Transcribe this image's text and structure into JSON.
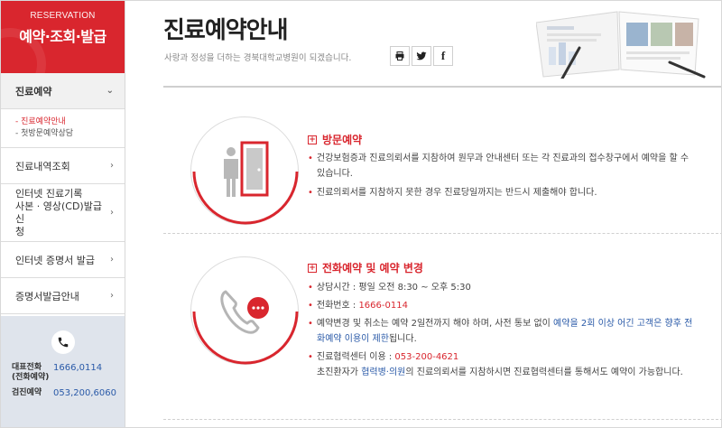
{
  "sidebar": {
    "header_eng": "RESERVATION",
    "header_title": "예약·조회·발급",
    "menu": {
      "reservation": "진료예약",
      "sub_guide": "- 진료예약안내",
      "sub_first": "- 첫방문예약상담",
      "history": "진료내역조회",
      "internet_record_1": "인터넷 진료기록",
      "internet_record_2": "사본 · 영상(CD)발급 신",
      "internet_record_3": "청",
      "cert_internet": "인터넷 증명서 발급",
      "cert_guide": "증명서발급안내"
    },
    "call": {
      "rep_label_1": "대표전화",
      "rep_label_2": "(전화예약)",
      "rep_num": "1666,0114",
      "check_label": "검진예약",
      "check_num": "053,200,6060"
    }
  },
  "header": {
    "title": "진료예약안내",
    "subtitle": "사랑과 정성을 더하는 경북대학교병원이 되겠습니다."
  },
  "share": {
    "print_icon": "print-icon",
    "twitter_icon": "twitter-icon",
    "facebook_icon": "facebook-icon",
    "facebook_glyph": "f"
  },
  "visit": {
    "title": "방문예약",
    "line1a": "건강보험증과 진료의뢰서를 지참하여 원무과 안내센터 또는 각 진료과의 접수창구에서 예약을 할 수",
    "line1b": "있습니다.",
    "line2": "진료의뢰서를 지참하지 못한 경우 진료당일까지는 반드시 제출해야 합니다."
  },
  "phone": {
    "title": "전화예약 및 예약 변경",
    "hours": "상담시간 : 평일 오전 8:30 ~ 오후 5:30",
    "tel_label": "전화번호 : ",
    "tel_num": "1666-0114",
    "change_a1": "예약변경 및 취소는 예약 2일전까지 해야 하며, 사전 통보 없이 ",
    "change_a2": "예약을 2회 이상 어긴 고객은 향후 전",
    "change_b1": "화예약 이용이 제한",
    "change_b2": "됩니다.",
    "center_label": "진료협력센터 이용 : ",
    "center_num": "053-200-4621",
    "center_b1": "초진환자가 ",
    "center_b2": "협력병·의원",
    "center_b3": "의 진료의뢰서를 지참하시면 진료협력센터를 통해서도 예약이 가능합니다."
  },
  "colors": {
    "accent": "#d9262e",
    "link": "#2a5aa8",
    "call_bg": "#dfe4ec"
  }
}
